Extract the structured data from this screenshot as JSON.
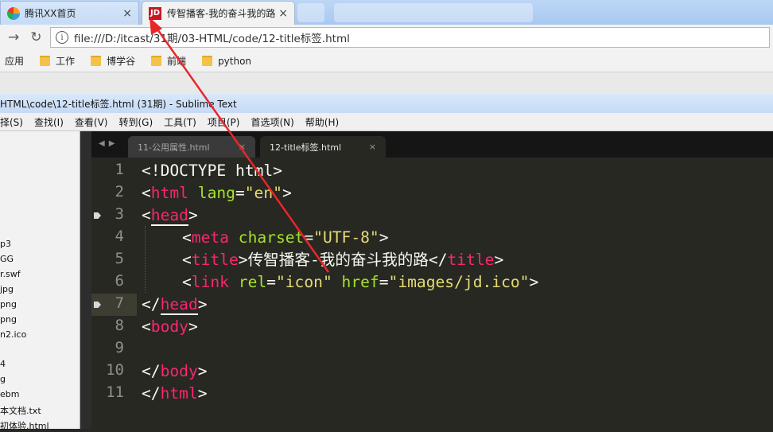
{
  "browser": {
    "tabs": [
      {
        "title": "腾讯XX首页",
        "close": "×"
      },
      {
        "title": "传智播客-我的奋斗我的路",
        "close": "×",
        "icon_text": "JD"
      }
    ],
    "url": "file:///D:/itcast/31期/03-HTML/code/12-title标签.html",
    "bookmarks": [
      "应用",
      "工作",
      "博学谷",
      "前端",
      "python"
    ]
  },
  "sublime": {
    "window_title": "HTML\\code\\12-title标签.html (31期) - Sublime Text",
    "menu": [
      "择(S)",
      "查找(I)",
      "查看(V)",
      "转到(G)",
      "工具(T)",
      "项目(P)",
      "首选项(N)",
      "帮助(H)"
    ],
    "sidebar_files": [
      "p3",
      "GG",
      "r.swf",
      "jpg",
      "png",
      "png",
      "n2.ico",
      "",
      "4",
      "g",
      "ebm",
      "本文档.txt",
      "初体验.html"
    ],
    "tabs": [
      {
        "name": "11-公用属性.html",
        "close": "×"
      },
      {
        "name": "12-title标签.html",
        "close": "×"
      }
    ],
    "line_numbers": [
      "1",
      "2",
      "3",
      "4",
      "5",
      "6",
      "7",
      "8",
      "9",
      "10",
      "11"
    ],
    "code": {
      "l1": "<!DOCTYPE html>",
      "l2_lt": "<",
      "l2_tag": "html",
      "l2_attr": " lang",
      "l2_eq": "=",
      "l2_val": "\"en\"",
      "l2_gt": ">",
      "l3_lt": "<",
      "l3_tag": "head",
      "l3_gt": ">",
      "l4_lt": "<",
      "l4_tag": "meta",
      "l4_attr": " charset",
      "l4_eq": "=",
      "l4_val": "\"UTF-8\"",
      "l4_gt": ">",
      "l5_lt": "<",
      "l5_tag": "title",
      "l5_gt": ">",
      "l5_text": "传智播客-我的奋斗我的路",
      "l5_close_lt": "</",
      "l5_close_tag": "title",
      "l5_close_gt": ">",
      "l6_lt": "<",
      "l6_tag": "link",
      "l6_attr1": " rel",
      "l6_eq1": "=",
      "l6_val1": "\"icon\"",
      "l6_attr2": " href",
      "l6_eq2": "=",
      "l6_val2": "\"images/jd.ico\"",
      "l6_gt": ">",
      "l7_lt": "</",
      "l7_tag": "head",
      "l7_gt": ">",
      "l8_lt": "<",
      "l8_tag": "body",
      "l8_gt": ">",
      "l10_lt": "</",
      "l10_tag": "body",
      "l10_gt": ">",
      "l11_lt": "</",
      "l11_tag": "html",
      "l11_gt": ">"
    }
  },
  "colors": {
    "tag": "#f92672",
    "attr": "#a6e22e",
    "string": "#e6db74",
    "annotation_arrow": "#e8262a"
  }
}
